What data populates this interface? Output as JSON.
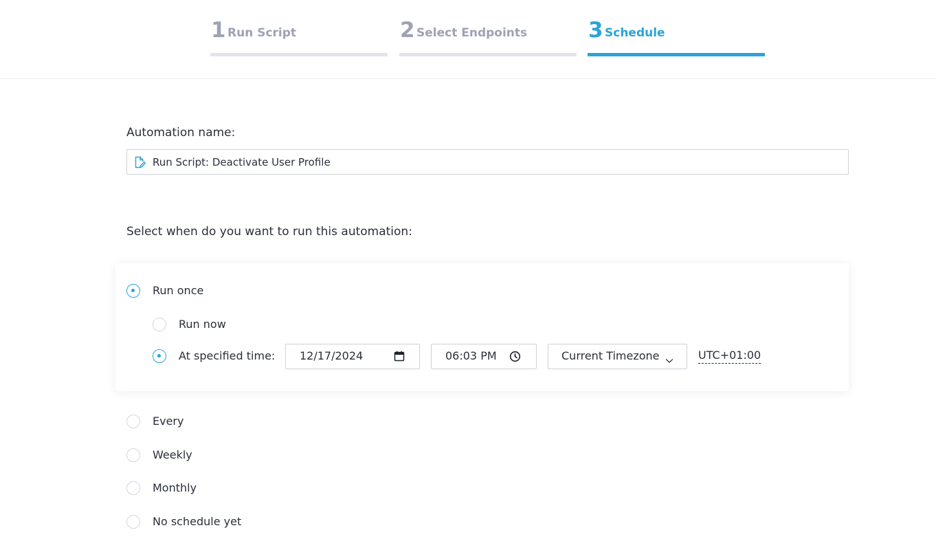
{
  "stepper": {
    "steps": [
      {
        "number": "1",
        "label": "Run Script",
        "active": false
      },
      {
        "number": "2",
        "label": "Select Endpoints",
        "active": false
      },
      {
        "number": "3",
        "label": "Schedule",
        "active": true
      }
    ],
    "active_color": "#2aa4d8",
    "inactive_color": "#9ea2b3"
  },
  "automation_name": {
    "label": "Automation name:",
    "value": "Run Script: Deactivate User Profile",
    "icon": "edit-document-icon"
  },
  "schedule": {
    "label": "Select when do you want to run this automation:",
    "options": {
      "run_once": {
        "label": "Run once",
        "checked": true
      },
      "run_now": {
        "label": "Run now",
        "checked": false
      },
      "at_specified_time": {
        "label": "At specified time:",
        "checked": true
      },
      "every": {
        "label": "Every",
        "checked": false
      },
      "weekly": {
        "label": "Weekly",
        "checked": false
      },
      "monthly": {
        "label": "Monthly",
        "checked": false
      },
      "no_schedule": {
        "label": "No schedule yet",
        "checked": false
      }
    },
    "date": {
      "value": "12/17/2024",
      "icon": "calendar-icon"
    },
    "time": {
      "value": "06:03 PM",
      "icon": "clock-icon"
    },
    "timezone": {
      "selected": "Current Timezone",
      "icon": "chevron-down-icon"
    },
    "utc_offset": "UTC+01:00"
  }
}
